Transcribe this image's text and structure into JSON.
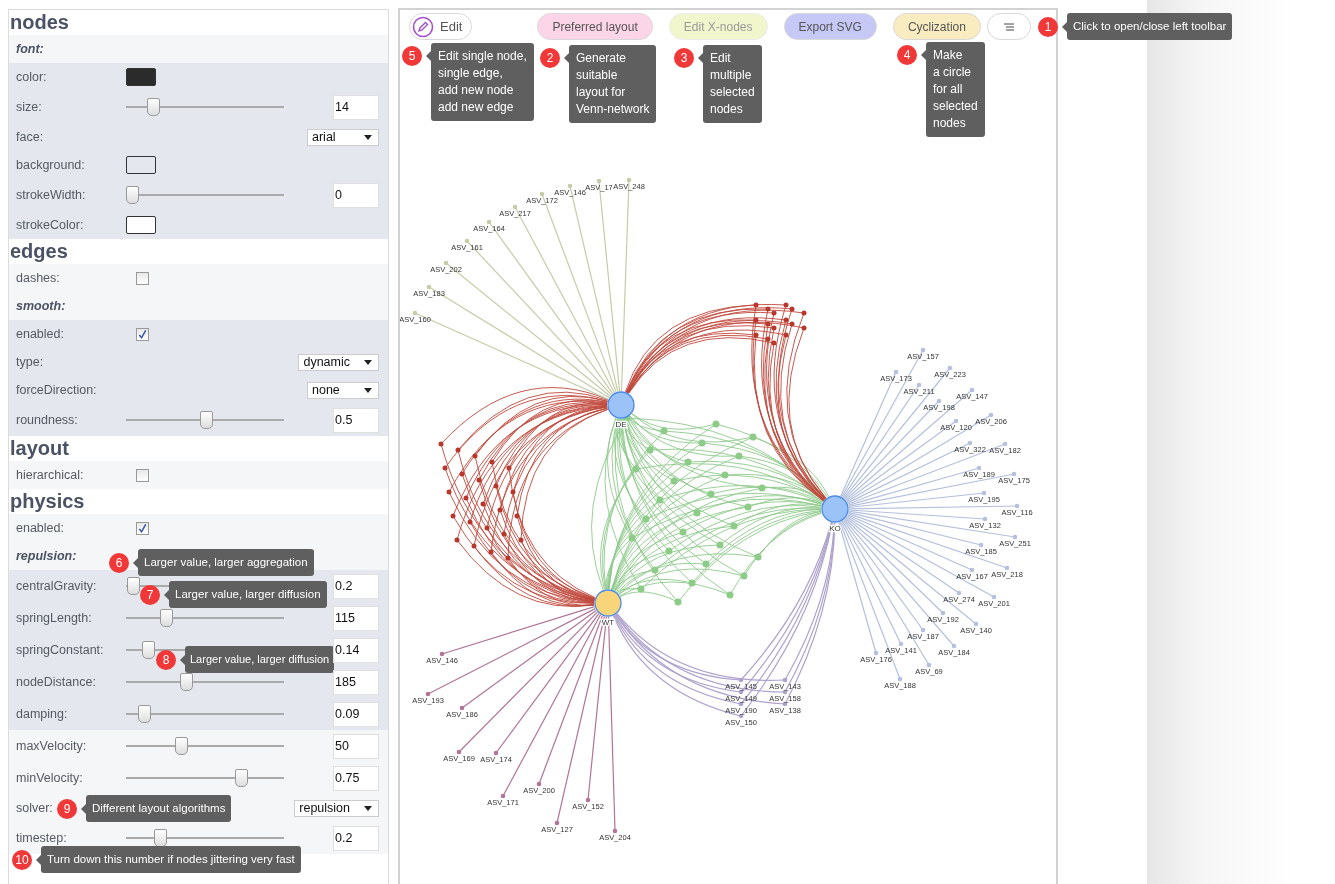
{
  "panel": {
    "sections": [
      {
        "title": "nodes",
        "items": [
          {
            "kind": "group",
            "label": "font:",
            "children": [
              {
                "kind": "color",
                "label": "color:",
                "color": "#2b2b2b"
              },
              {
                "kind": "slider",
                "label": "size:",
                "level": 0.14,
                "value": "14"
              },
              {
                "kind": "select",
                "label": "face:",
                "value": "arial"
              },
              {
                "kind": "color",
                "label": "background:",
                "color": "#e4e8ee"
              },
              {
                "kind": "slider",
                "label": "strokeWidth:",
                "level": 0,
                "value": "0"
              },
              {
                "kind": "color",
                "label": "strokeColor:",
                "color": "#ffffff"
              }
            ]
          }
        ]
      },
      {
        "title": "edges",
        "items": [
          {
            "kind": "checkbox",
            "label": "dashes:",
            "checked": false
          },
          {
            "kind": "group",
            "label": "smooth:",
            "children": [
              {
                "kind": "checkbox",
                "label": "enabled:",
                "checked": true
              },
              {
                "kind": "select",
                "label": "type:",
                "value": "dynamic"
              },
              {
                "kind": "select",
                "label": "forceDirection:",
                "value": "none"
              },
              {
                "kind": "slider",
                "label": "roundness:",
                "level": 0.5,
                "value": "0.5"
              }
            ]
          }
        ]
      },
      {
        "title": "layout",
        "items": [
          {
            "kind": "checkbox",
            "label": "hierarchical:",
            "checked": false
          }
        ]
      },
      {
        "title": "physics",
        "items": [
          {
            "kind": "checkbox",
            "label": "enabled:",
            "checked": true
          },
          {
            "kind": "group",
            "label": "repulsion:",
            "children": [
              {
                "kind": "slider",
                "label": "centralGravity:",
                "level": 0.01,
                "value": "0.2"
              },
              {
                "kind": "slider",
                "label": "springLength:",
                "level": 0.23,
                "value": "115"
              },
              {
                "kind": "slider",
                "label": "springConstant:",
                "level": 0.11,
                "value": "0.14"
              },
              {
                "kind": "slider",
                "label": "nodeDistance:",
                "level": 0.37,
                "value": "185"
              },
              {
                "kind": "slider",
                "label": "damping:",
                "level": 0.085,
                "value": "0.09"
              }
            ]
          },
          {
            "kind": "slider",
            "label": "maxVelocity:",
            "level": 0.33,
            "value": "50"
          },
          {
            "kind": "slider",
            "label": "minVelocity:",
            "level": 0.74,
            "value": "0.75"
          },
          {
            "kind": "select",
            "label": "solver:",
            "value": "repulsion"
          },
          {
            "kind": "slider",
            "label": "timestep:",
            "level": 0.19,
            "value": "0.2"
          }
        ]
      }
    ]
  },
  "toolbar": {
    "buttons": [
      {
        "kind": "edit",
        "label": "Edit",
        "color": "#ffffff",
        "disabled": false
      },
      {
        "kind": "text",
        "label": "Preferred layout",
        "color": "#fdd5e8",
        "disabled": false
      },
      {
        "kind": "text",
        "label": "Edit X-nodes",
        "color": "#f2f6cc",
        "disabled": true
      },
      {
        "kind": "text",
        "label": "Export SVG",
        "color": "#c6c8f6",
        "disabled": false
      },
      {
        "kind": "text",
        "label": "Cyclization",
        "color": "#f9ecc0",
        "disabled": false
      },
      {
        "kind": "menu",
        "color": "#ffffff",
        "disabled": false
      }
    ]
  },
  "network": {
    "hubs": [
      {
        "label": "DE",
        "color": "#9cc3f7"
      },
      {
        "label": "WT",
        "color": "#f9d57a"
      },
      {
        "label": "KO",
        "color": "#9cc3f7"
      }
    ],
    "fans": [
      {
        "kind": "single",
        "color": "#c4cca8",
        "labels": [
          "ASV_248",
          "ASV_17",
          "ASV_146",
          "ASV_172",
          "ASV_217",
          "ASV_164",
          "ASV_161",
          "ASV_202",
          "ASV_183",
          "ASV_160"
        ]
      },
      {
        "kind": "single",
        "color": "#b4c0dc",
        "labels": [
          "ASV_173",
          "ASV_157",
          "ASV_211",
          "ASV_223",
          "ASV_198",
          "ASV_147",
          "ASV_120",
          "ASV_206",
          "ASV_322",
          "ASV_182",
          "ASV_189",
          "ASV_175",
          "ASV_195",
          "ASV_116",
          "ASV_132",
          "ASV_251",
          "ASV_185",
          "ASV_218",
          "ASV_167",
          "ASV_201",
          "ASV_274",
          "ASV_140",
          "ASV_192",
          "ASV_184",
          "ASV_187",
          "ASV_69",
          "ASV_141",
          "ASV_188",
          "ASV_176"
        ]
      },
      {
        "kind": "single",
        "color": "#b07598",
        "labels": [
          "ASV_146",
          "ASV_193",
          "ASV_186",
          "ASV_169",
          "ASV_174",
          "ASV_171",
          "ASV_200",
          "ASV_127",
          "ASV_152",
          "ASV_204"
        ]
      },
      {
        "kind": "shared",
        "color": "#aea2cc",
        "labels": [
          "ASV_145",
          "ASV_143",
          "ASV_149",
          "ASV_158",
          "ASV_190",
          "ASV_138",
          "ASV_150"
        ]
      }
    ]
  },
  "annotations": [
    {
      "number": "1",
      "text": "Click to open/close left toolbar"
    },
    {
      "number": "5",
      "text": "Edit single node,\nsingle edge,\nadd new node\nadd new edge"
    },
    {
      "number": "2",
      "text": "Generate\nsuitable\nlayout for\nVenn-network"
    },
    {
      "number": "3",
      "text": "Edit\nmultiple\nselected\nnodes"
    },
    {
      "number": "4",
      "text": "Make\na circle\nfor all\nselected\nnodes"
    },
    {
      "number": "6",
      "text": "Larger value, larger aggregation"
    },
    {
      "number": "7",
      "text": "Larger value, larger diffusion"
    },
    {
      "number": "8",
      "text": "Larger value, larger diffusion"
    },
    {
      "number": "9",
      "text": "Different layout algorithms"
    },
    {
      "number": "10",
      "text": "Turn down this number if nodes jittering very fast"
    }
  ]
}
